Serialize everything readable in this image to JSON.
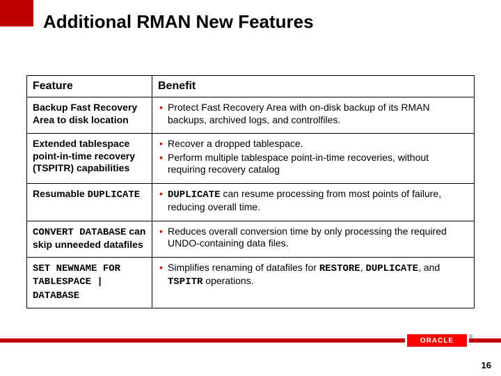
{
  "title": "Additional RMAN New Features",
  "headers": {
    "feature": "Feature",
    "benefit": "Benefit"
  },
  "rows": [
    {
      "feature_html": "Backup Fast Recovery Area to disk location",
      "benefits": [
        "Protect Fast Recovery Area with on-disk backup of its RMAN backups, archived logs, and controlfiles."
      ]
    },
    {
      "feature_html": "Extended tablespace point-in-time recovery (TSPITR) capabilities",
      "benefits": [
        "Recover a dropped tablespace.",
        "Perform multiple tablespace point-in-time recoveries, without requiring recovery catalog"
      ]
    },
    {
      "feature_html": "Resumable <span class=\"mono\">DUPLICATE</span>",
      "benefits": [
        "<span class=\"mono\">DUPLICATE</span> can resume processing from most points of failure, reducing overall time."
      ]
    },
    {
      "feature_html": "<span class=\"mono\">CONVERT DATABASE</span> can skip unneeded datafiles",
      "benefits": [
        "Reduces overall conversion time by only processing the required UNDO-containing data files."
      ]
    },
    {
      "feature_html": "<span class=\"mono\">SET NEWNAME FOR TABLESPACE | DATABASE</span>",
      "benefits": [
        "Simplifies renaming of datafiles for <span class=\"mono\">RESTORE</span>, <span class=\"mono\">DUPLICATE</span>, and <span class=\"mono\">TSPITR</span> operations."
      ]
    }
  ],
  "logo": "ORACLE",
  "logo_reg": "®",
  "page_number": "16"
}
